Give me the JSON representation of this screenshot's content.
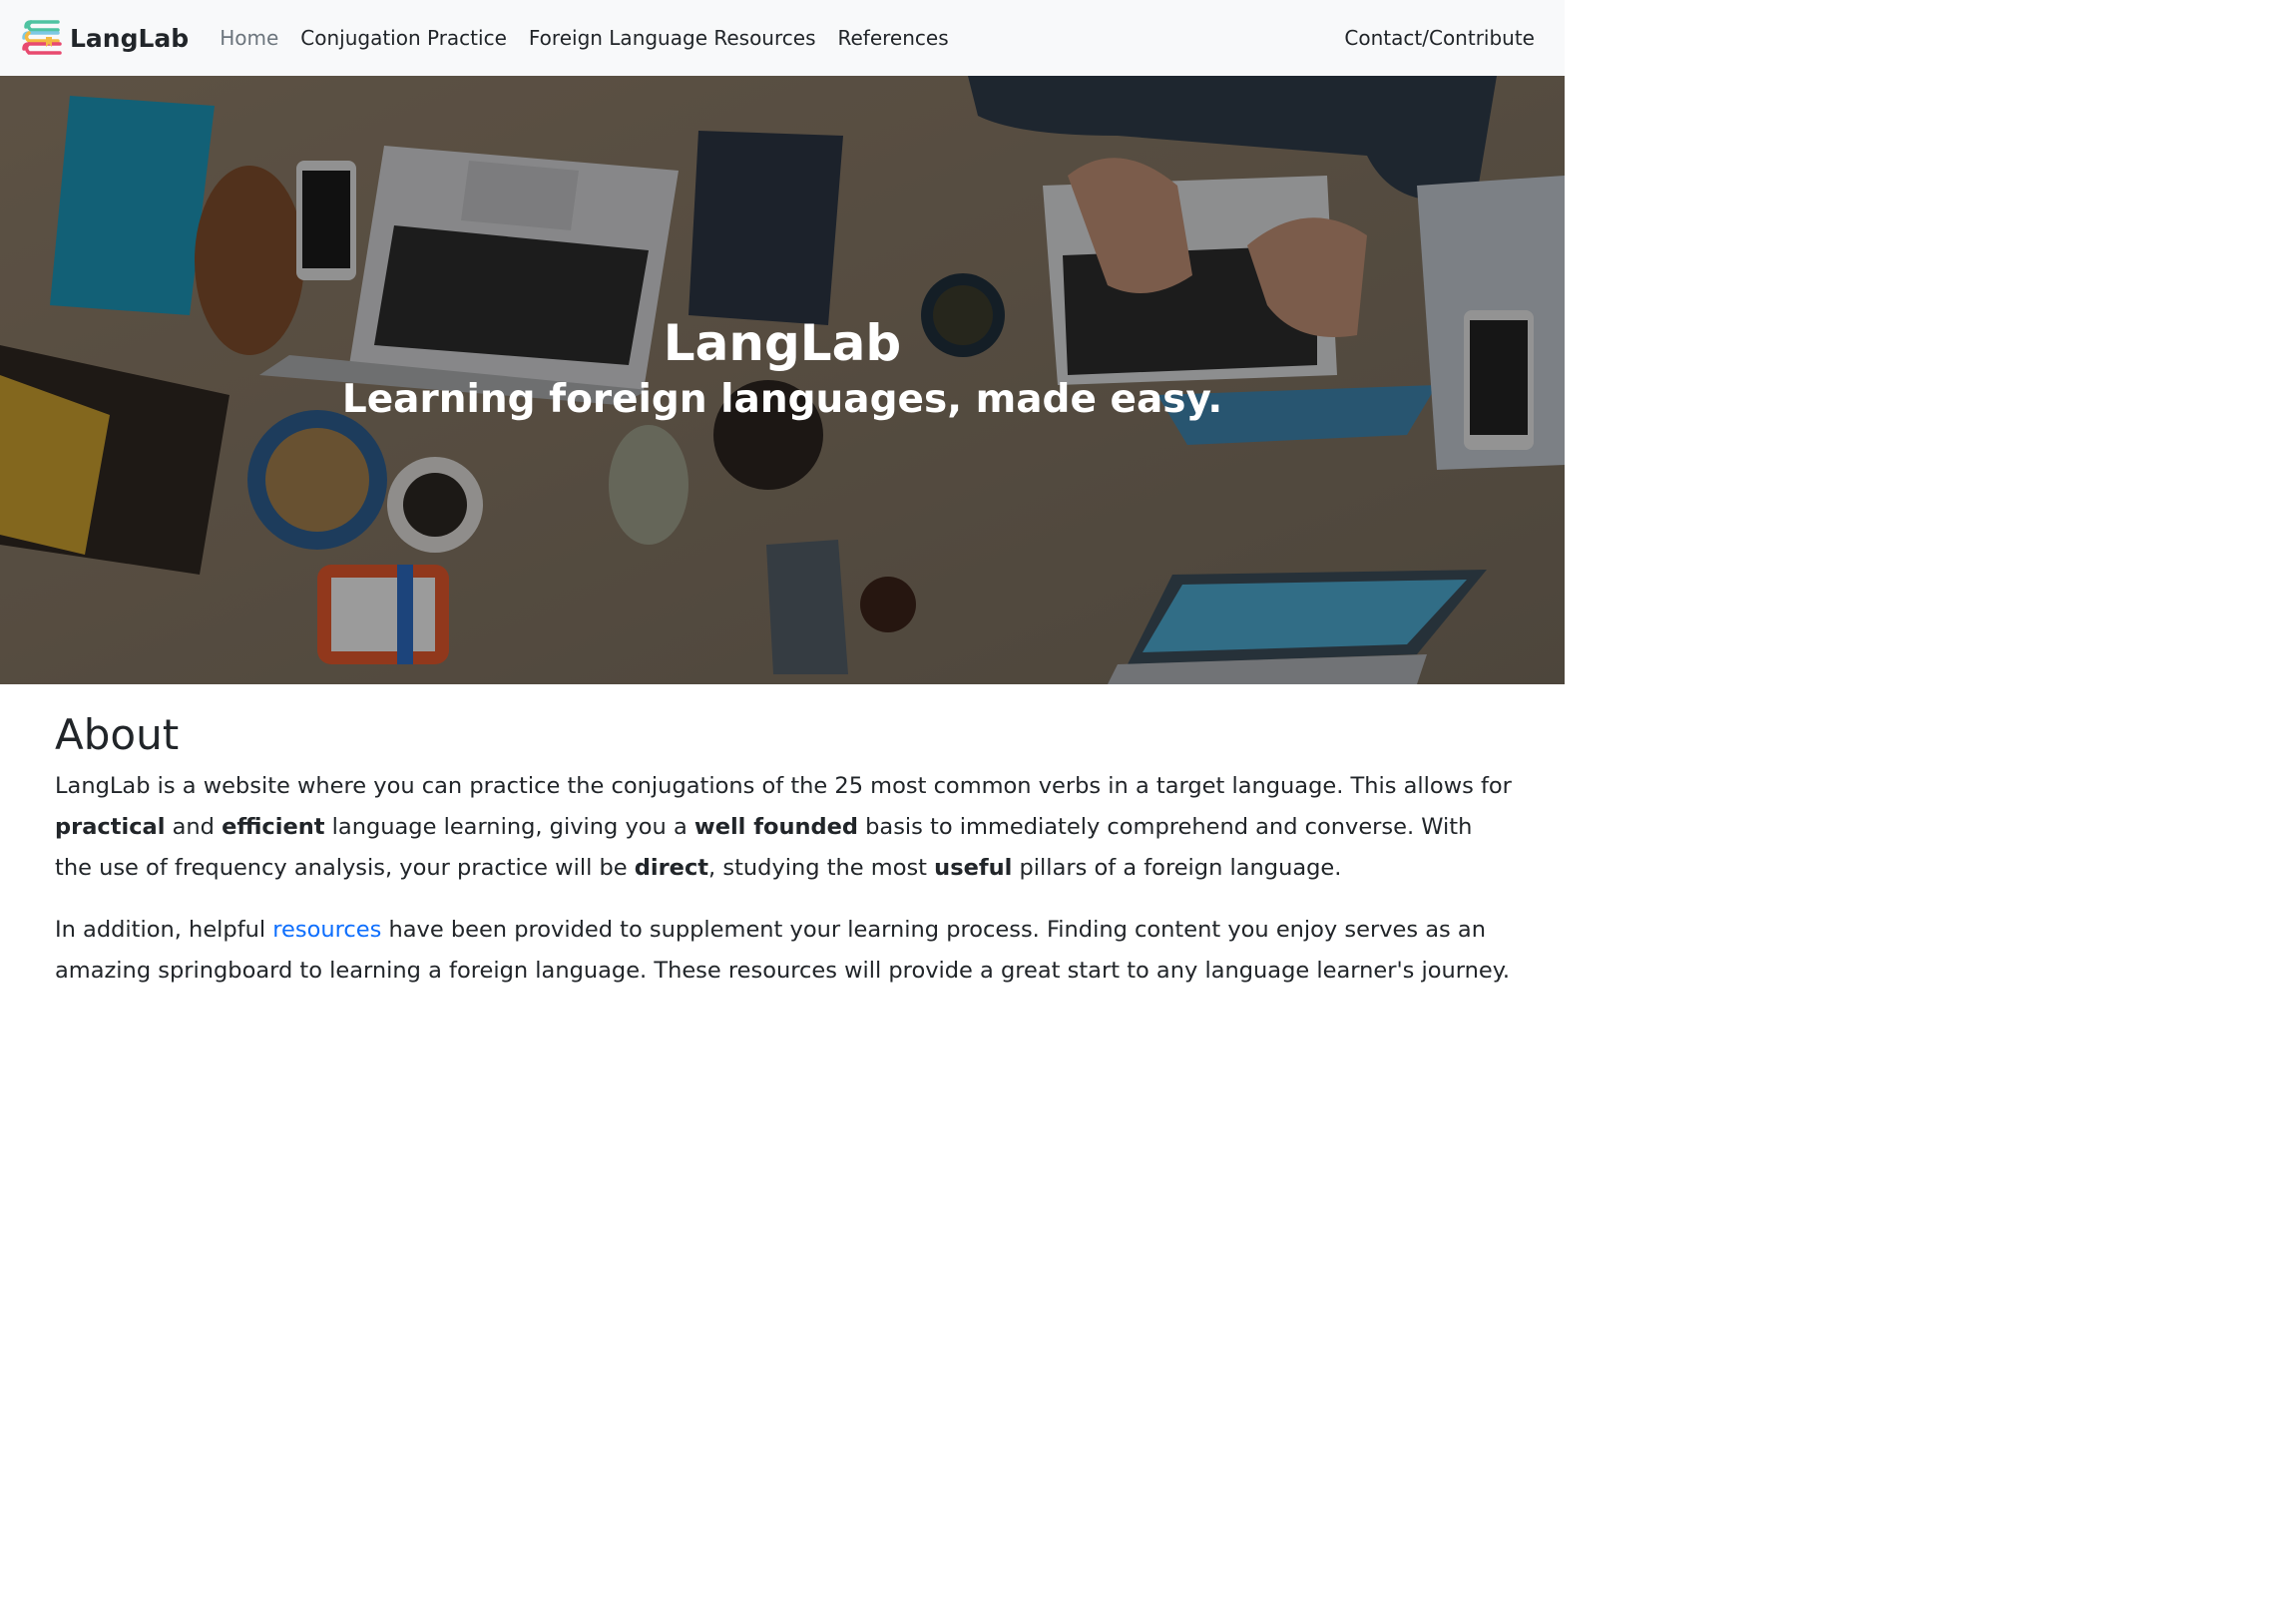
{
  "navbar": {
    "brand": "LangLab",
    "links": [
      {
        "label": "Home",
        "active": false
      },
      {
        "label": "Conjugation Practice"
      },
      {
        "label": "Foreign Language Resources"
      },
      {
        "label": "References"
      }
    ],
    "right_link": "Contact/Contribute"
  },
  "hero": {
    "title": "LangLab",
    "subtitle": "Learning foreign languages, made easy."
  },
  "about": {
    "heading": "About",
    "p1": {
      "t1": "LangLab is a website where you can practice the conjugations of the 25 most common verbs in a target language. This allows for ",
      "b1": "practical",
      "t2": " and ",
      "b2": "efficient",
      "t3": " language learning, giving you a ",
      "b3": "well founded",
      "t4": " basis to immediately comprehend and converse. With the use of frequency analysis, your practice will be ",
      "b4": "direct",
      "t5": ", studying the most ",
      "b5": "useful",
      "t6": " pillars of a foreign language."
    },
    "p2": {
      "t1": "In addition, helpful ",
      "link": "resources",
      "t2": " have been provided to supplement your learning process. Finding content you enjoy serves as an amazing springboard to learning a foreign language. These resources will provide a great start to any language learner's journey."
    }
  },
  "colors": {
    "navbar_bg": "#f8f9fa",
    "link": "#0d6efd",
    "muted_nav": "#6c757d"
  }
}
